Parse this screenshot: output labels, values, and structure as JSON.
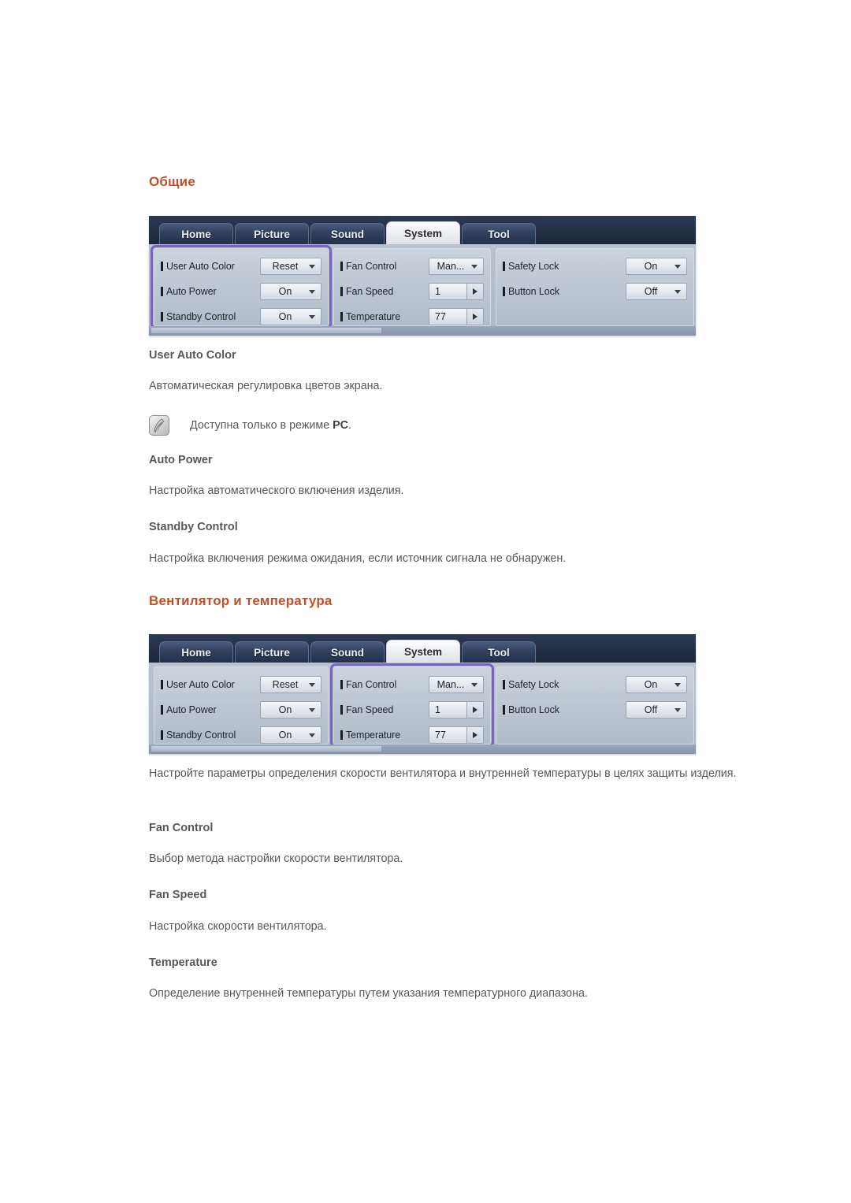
{
  "sections": [
    {
      "title": "Общие",
      "osd": {
        "tabs": [
          {
            "label": "Home",
            "active": false
          },
          {
            "label": "Picture",
            "active": false
          },
          {
            "label": "Sound",
            "active": false
          },
          {
            "label": "System",
            "active": true
          },
          {
            "label": "Tool",
            "active": false
          }
        ],
        "highlight_panel": 0,
        "panels": [
          {
            "rows": [
              {
                "label": "User Auto Color",
                "value": "Reset",
                "control": "dropdown"
              },
              {
                "label": "Auto Power",
                "value": "On",
                "control": "dropdown"
              },
              {
                "label": "Standby Control",
                "value": "On",
                "control": "dropdown"
              }
            ]
          },
          {
            "rows": [
              {
                "label": "Fan Control",
                "value": "Man...",
                "control": "dropdown"
              },
              {
                "label": "Fan Speed",
                "value": "1",
                "control": "spinner"
              },
              {
                "label": "Temperature",
                "value": "77",
                "control": "spinner"
              }
            ]
          },
          {
            "rows": [
              {
                "label": "Safety Lock",
                "value": "On",
                "control": "dropdown"
              },
              {
                "label": "Button Lock",
                "value": "Off",
                "control": "dropdown"
              }
            ]
          }
        ]
      },
      "items": [
        {
          "heading": "User Auto Color",
          "body": "Автоматическая регулировка цветов экрана.",
          "note": {
            "icon": "note-pencil-icon",
            "text_before": "Доступна только в режиме ",
            "text_bold": "PC",
            "text_after": "."
          }
        },
        {
          "heading": "Auto Power",
          "body": "Настройка автоматического включения изделия."
        },
        {
          "heading": "Standby Control",
          "body": "Настройка включения режима ожидания, если источник сигнала не обнаружен."
        }
      ]
    },
    {
      "title": "Вентилятор и температура",
      "osd": {
        "tabs": [
          {
            "label": "Home",
            "active": false
          },
          {
            "label": "Picture",
            "active": false
          },
          {
            "label": "Sound",
            "active": false
          },
          {
            "label": "System",
            "active": true
          },
          {
            "label": "Tool",
            "active": false
          }
        ],
        "highlight_panel": 1,
        "panels": [
          {
            "rows": [
              {
                "label": "User Auto Color",
                "value": "Reset",
                "control": "dropdown"
              },
              {
                "label": "Auto Power",
                "value": "On",
                "control": "dropdown"
              },
              {
                "label": "Standby Control",
                "value": "On",
                "control": "dropdown"
              }
            ]
          },
          {
            "rows": [
              {
                "label": "Fan Control",
                "value": "Man...",
                "control": "dropdown"
              },
              {
                "label": "Fan Speed",
                "value": "1",
                "control": "spinner"
              },
              {
                "label": "Temperature",
                "value": "77",
                "control": "spinner"
              }
            ]
          },
          {
            "rows": [
              {
                "label": "Safety Lock",
                "value": "On",
                "control": "dropdown"
              },
              {
                "label": "Button Lock",
                "value": "Off",
                "control": "dropdown"
              }
            ]
          }
        ]
      },
      "intro": "Настройте параметры определения скорости вентилятора и внутренней температуры в целях защиты изделия.",
      "items": [
        {
          "heading": "Fan Control",
          "body": "Выбор метода настройки скорости вентилятора."
        },
        {
          "heading": "Fan Speed",
          "body": "Настройка скорости вентилятора."
        },
        {
          "heading": "Temperature",
          "body": "Определение внутренней температуры путем указания температурного диапазона."
        }
      ]
    }
  ],
  "colors": {
    "heading": "#c0502a",
    "text": "#58585b",
    "highlight": "#7b61c4",
    "osd_tabbar": "#253149",
    "osd_panel": "#bcc5d1"
  }
}
